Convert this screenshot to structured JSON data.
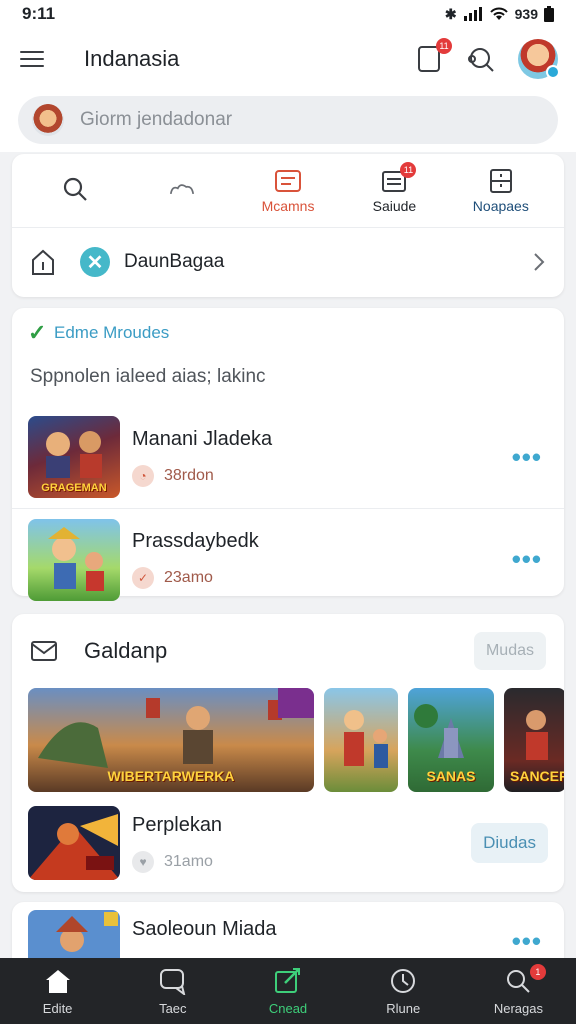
{
  "status_bar": {
    "time": "9:11",
    "right_text": "939"
  },
  "header": {
    "title": "Indanasia",
    "notif_badge": "11"
  },
  "search": {
    "placeholder": "Giorm jendadonar"
  },
  "nav": {
    "items": [
      {
        "label": "",
        "icon": "search-icon",
        "color": "#3a3d42"
      },
      {
        "label": "",
        "icon": "cloud-icon",
        "color": "#6b6f75"
      },
      {
        "label": "Mcamns",
        "icon": "inbox-icon",
        "color": "#d9533a"
      },
      {
        "label": "Saiude",
        "icon": "calendar-icon",
        "color": "#3a3d42",
        "badge": "11"
      },
      {
        "label": "Noapaes",
        "icon": "archive-icon",
        "color": "#1e4e79"
      }
    ]
  },
  "shortcut": {
    "label": "DaunBagaa"
  },
  "section1": {
    "title": "Edme Mroudes",
    "subtitle": "Sppnolen ialeed aias; lakinc",
    "items": [
      {
        "title": "Manani Jladeka",
        "meta": "38rdon",
        "thumb_caption": "GRAGEMAN"
      },
      {
        "title": "Prassdaybedk",
        "meta": "23amo",
        "thumb_caption": ""
      }
    ]
  },
  "gallery": {
    "title": "Galdanp",
    "action": "Mudas",
    "tiles": [
      {
        "caption": "WIBERTARWERKA"
      },
      {
        "caption": ""
      },
      {
        "caption": "SANAS"
      },
      {
        "caption": "SANCER"
      }
    ],
    "item": {
      "title": "Perplekan",
      "meta": "31amo",
      "action": "Diudas"
    }
  },
  "partial_item": {
    "title": "Saoleoun Miada"
  },
  "bottom_nav": {
    "items": [
      {
        "label": "Edite",
        "icon": "home-icon"
      },
      {
        "label": "Taec",
        "icon": "chat-icon"
      },
      {
        "label": "Cnead",
        "icon": "compose-icon",
        "active": true
      },
      {
        "label": "Rlune",
        "icon": "clock-icon"
      },
      {
        "label": "Neragas",
        "icon": "search-icon",
        "badge": "1"
      }
    ]
  }
}
